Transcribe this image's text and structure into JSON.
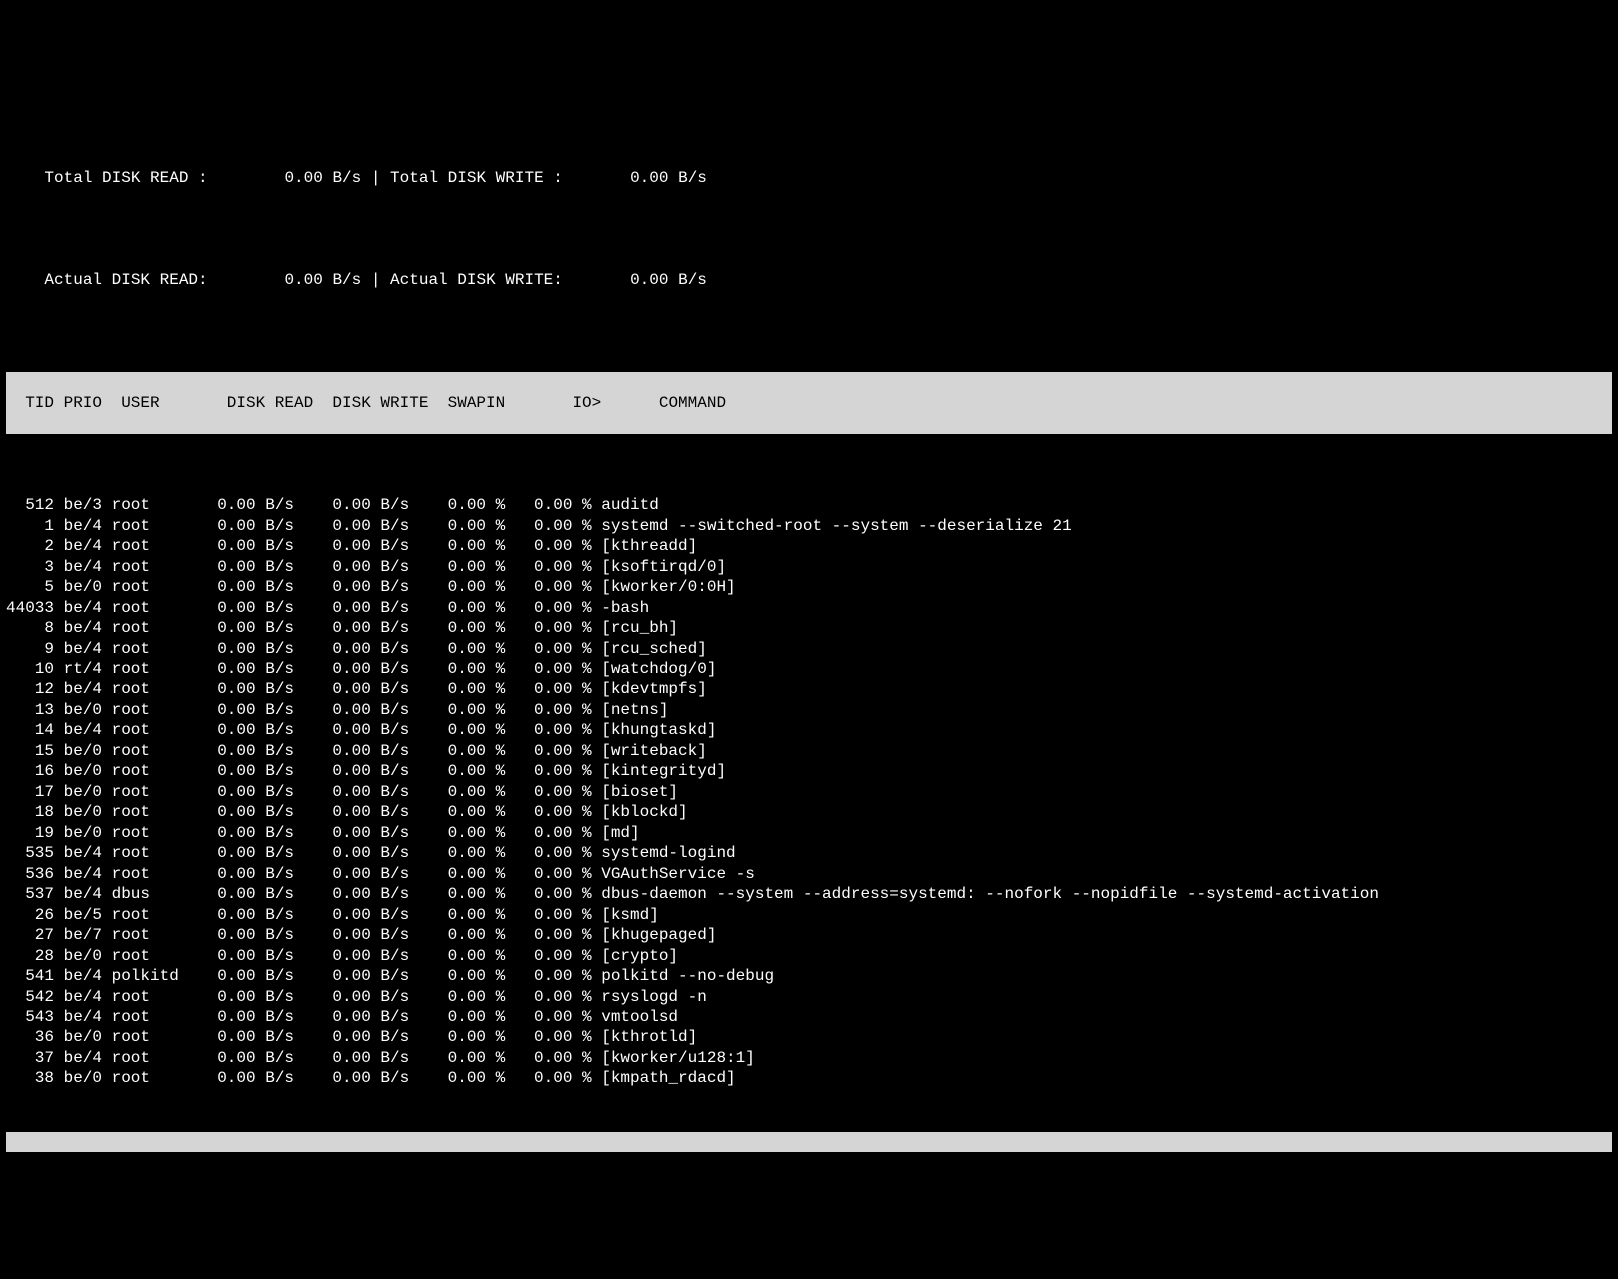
{
  "summary": {
    "total_read_label": "Total DISK READ :",
    "total_read_value": "0.00 B/s",
    "total_write_label": "Total DISK WRITE :",
    "total_write_value": "0.00 B/s",
    "actual_read_label": "Actual DISK READ:",
    "actual_read_value": "0.00 B/s",
    "actual_write_label": "Actual DISK WRITE:",
    "actual_write_value": "0.00 B/s",
    "sep": "|"
  },
  "headers": {
    "tid": "TID",
    "prio": "PRIO",
    "user": "USER",
    "disk_read": "DISK READ",
    "disk_write": "DISK WRITE",
    "swapin": "SWAPIN",
    "io": "IO>",
    "command": "COMMAND"
  },
  "rows": [
    {
      "tid": "512",
      "prio": "be/3",
      "user": "root",
      "dr": "0.00 B/s",
      "dw": "0.00 B/s",
      "sw": "0.00",
      "io": "0.00",
      "cmd": "auditd"
    },
    {
      "tid": "1",
      "prio": "be/4",
      "user": "root",
      "dr": "0.00 B/s",
      "dw": "0.00 B/s",
      "sw": "0.00",
      "io": "0.00",
      "cmd": "systemd --switched-root --system --deserialize 21"
    },
    {
      "tid": "2",
      "prio": "be/4",
      "user": "root",
      "dr": "0.00 B/s",
      "dw": "0.00 B/s",
      "sw": "0.00",
      "io": "0.00",
      "cmd": "[kthreadd]"
    },
    {
      "tid": "3",
      "prio": "be/4",
      "user": "root",
      "dr": "0.00 B/s",
      "dw": "0.00 B/s",
      "sw": "0.00",
      "io": "0.00",
      "cmd": "[ksoftirqd/0]"
    },
    {
      "tid": "5",
      "prio": "be/0",
      "user": "root",
      "dr": "0.00 B/s",
      "dw": "0.00 B/s",
      "sw": "0.00",
      "io": "0.00",
      "cmd": "[kworker/0:0H]"
    },
    {
      "tid": "44033",
      "prio": "be/4",
      "user": "root",
      "dr": "0.00 B/s",
      "dw": "0.00 B/s",
      "sw": "0.00",
      "io": "0.00",
      "cmd": "-bash"
    },
    {
      "tid": "8",
      "prio": "be/4",
      "user": "root",
      "dr": "0.00 B/s",
      "dw": "0.00 B/s",
      "sw": "0.00",
      "io": "0.00",
      "cmd": "[rcu_bh]"
    },
    {
      "tid": "9",
      "prio": "be/4",
      "user": "root",
      "dr": "0.00 B/s",
      "dw": "0.00 B/s",
      "sw": "0.00",
      "io": "0.00",
      "cmd": "[rcu_sched]"
    },
    {
      "tid": "10",
      "prio": "rt/4",
      "user": "root",
      "dr": "0.00 B/s",
      "dw": "0.00 B/s",
      "sw": "0.00",
      "io": "0.00",
      "cmd": "[watchdog/0]"
    },
    {
      "tid": "12",
      "prio": "be/4",
      "user": "root",
      "dr": "0.00 B/s",
      "dw": "0.00 B/s",
      "sw": "0.00",
      "io": "0.00",
      "cmd": "[kdevtmpfs]"
    },
    {
      "tid": "13",
      "prio": "be/0",
      "user": "root",
      "dr": "0.00 B/s",
      "dw": "0.00 B/s",
      "sw": "0.00",
      "io": "0.00",
      "cmd": "[netns]"
    },
    {
      "tid": "14",
      "prio": "be/4",
      "user": "root",
      "dr": "0.00 B/s",
      "dw": "0.00 B/s",
      "sw": "0.00",
      "io": "0.00",
      "cmd": "[khungtaskd]"
    },
    {
      "tid": "15",
      "prio": "be/0",
      "user": "root",
      "dr": "0.00 B/s",
      "dw": "0.00 B/s",
      "sw": "0.00",
      "io": "0.00",
      "cmd": "[writeback]"
    },
    {
      "tid": "16",
      "prio": "be/0",
      "user": "root",
      "dr": "0.00 B/s",
      "dw": "0.00 B/s",
      "sw": "0.00",
      "io": "0.00",
      "cmd": "[kintegrityd]"
    },
    {
      "tid": "17",
      "prio": "be/0",
      "user": "root",
      "dr": "0.00 B/s",
      "dw": "0.00 B/s",
      "sw": "0.00",
      "io": "0.00",
      "cmd": "[bioset]"
    },
    {
      "tid": "18",
      "prio": "be/0",
      "user": "root",
      "dr": "0.00 B/s",
      "dw": "0.00 B/s",
      "sw": "0.00",
      "io": "0.00",
      "cmd": "[kblockd]"
    },
    {
      "tid": "19",
      "prio": "be/0",
      "user": "root",
      "dr": "0.00 B/s",
      "dw": "0.00 B/s",
      "sw": "0.00",
      "io": "0.00",
      "cmd": "[md]"
    },
    {
      "tid": "535",
      "prio": "be/4",
      "user": "root",
      "dr": "0.00 B/s",
      "dw": "0.00 B/s",
      "sw": "0.00",
      "io": "0.00",
      "cmd": "systemd-logind"
    },
    {
      "tid": "536",
      "prio": "be/4",
      "user": "root",
      "dr": "0.00 B/s",
      "dw": "0.00 B/s",
      "sw": "0.00",
      "io": "0.00",
      "cmd": "VGAuthService -s"
    },
    {
      "tid": "537",
      "prio": "be/4",
      "user": "dbus",
      "dr": "0.00 B/s",
      "dw": "0.00 B/s",
      "sw": "0.00",
      "io": "0.00",
      "cmd": "dbus-daemon --system --address=systemd: --nofork --nopidfile --systemd-activation"
    },
    {
      "tid": "26",
      "prio": "be/5",
      "user": "root",
      "dr": "0.00 B/s",
      "dw": "0.00 B/s",
      "sw": "0.00",
      "io": "0.00",
      "cmd": "[ksmd]"
    },
    {
      "tid": "27",
      "prio": "be/7",
      "user": "root",
      "dr": "0.00 B/s",
      "dw": "0.00 B/s",
      "sw": "0.00",
      "io": "0.00",
      "cmd": "[khugepaged]"
    },
    {
      "tid": "28",
      "prio": "be/0",
      "user": "root",
      "dr": "0.00 B/s",
      "dw": "0.00 B/s",
      "sw": "0.00",
      "io": "0.00",
      "cmd": "[crypto]"
    },
    {
      "tid": "541",
      "prio": "be/4",
      "user": "polkitd",
      "dr": "0.00 B/s",
      "dw": "0.00 B/s",
      "sw": "0.00",
      "io": "0.00",
      "cmd": "polkitd --no-debug"
    },
    {
      "tid": "542",
      "prio": "be/4",
      "user": "root",
      "dr": "0.00 B/s",
      "dw": "0.00 B/s",
      "sw": "0.00",
      "io": "0.00",
      "cmd": "rsyslogd -n"
    },
    {
      "tid": "543",
      "prio": "be/4",
      "user": "root",
      "dr": "0.00 B/s",
      "dw": "0.00 B/s",
      "sw": "0.00",
      "io": "0.00",
      "cmd": "vmtoolsd"
    },
    {
      "tid": "36",
      "prio": "be/0",
      "user": "root",
      "dr": "0.00 B/s",
      "dw": "0.00 B/s",
      "sw": "0.00",
      "io": "0.00",
      "cmd": "[kthrotld]"
    },
    {
      "tid": "37",
      "prio": "be/4",
      "user": "root",
      "dr": "0.00 B/s",
      "dw": "0.00 B/s",
      "sw": "0.00",
      "io": "0.00",
      "cmd": "[kworker/u128:1]"
    },
    {
      "tid": "38",
      "prio": "be/0",
      "user": "root",
      "dr": "0.00 B/s",
      "dw": "0.00 B/s",
      "sw": "0.00",
      "io": "0.00",
      "cmd": "[kmpath_rdacd]"
    }
  ]
}
